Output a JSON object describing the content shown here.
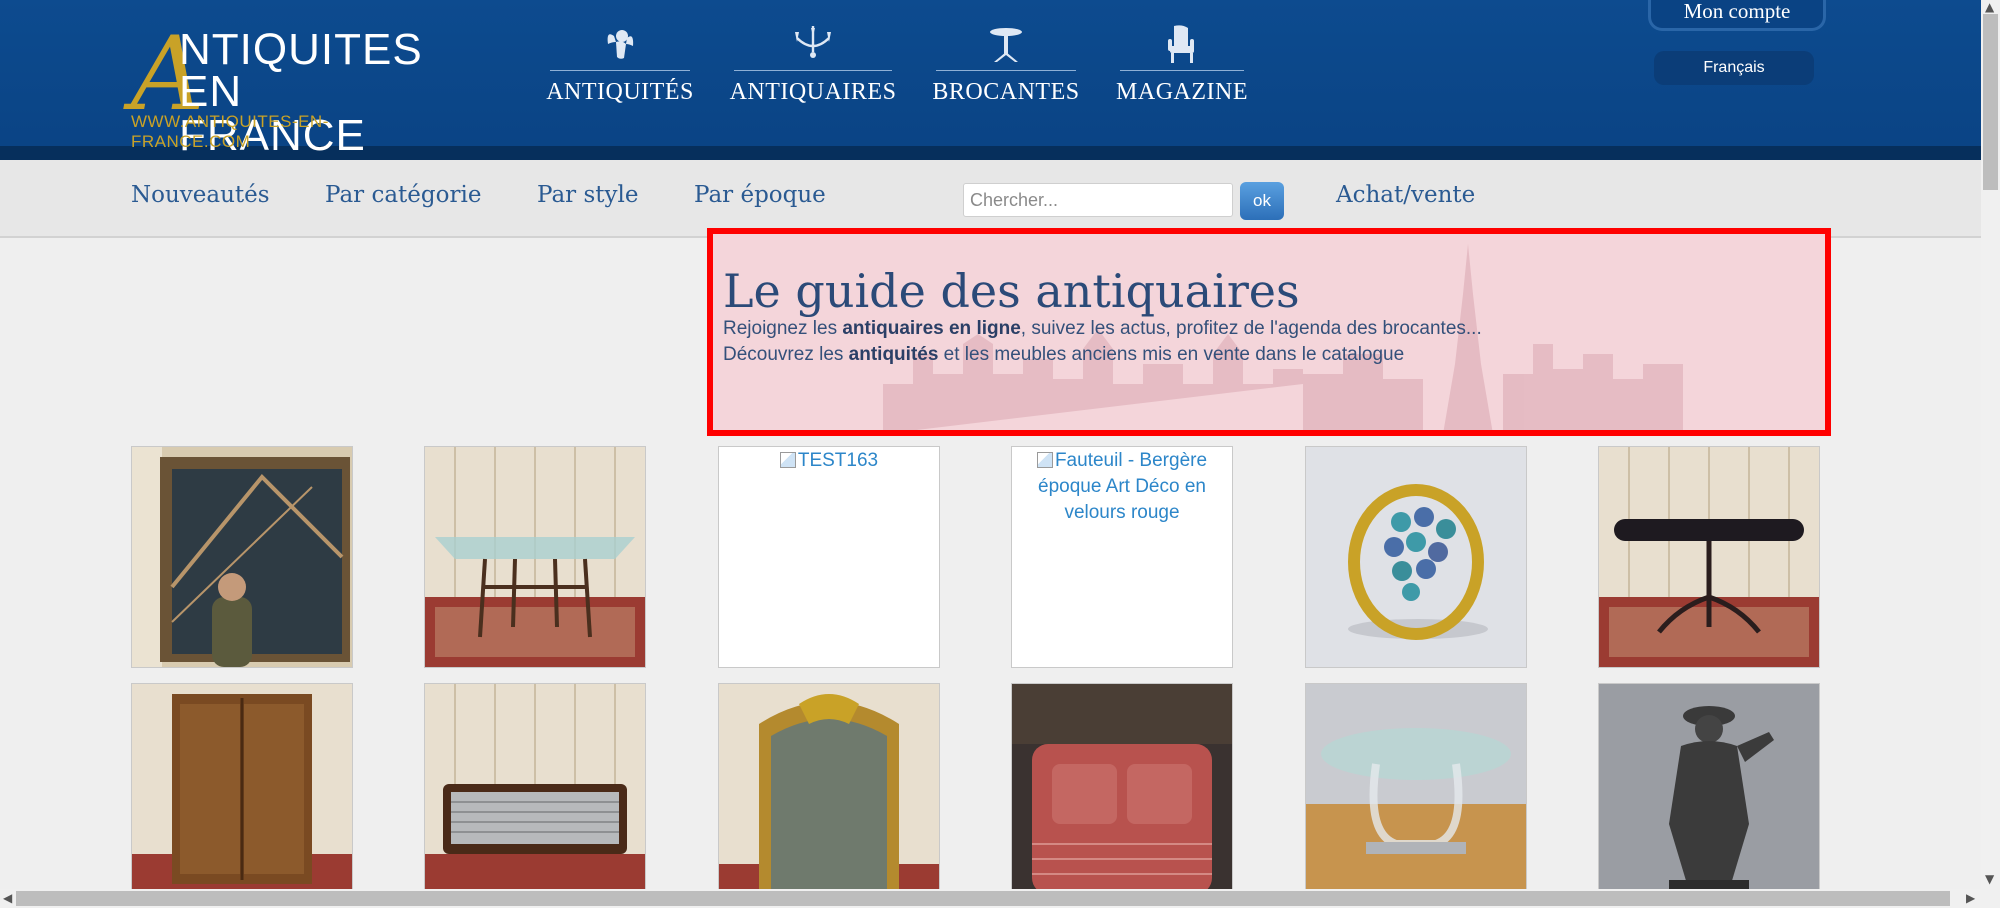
{
  "header": {
    "logo": {
      "letter": "A",
      "line1": "NTIQUITES",
      "line2": "EN FRANCE",
      "url": "WWW.ANTIQUITES-EN-FRANCE.COM"
    },
    "nav": [
      {
        "label": "ANTIQUITÉS",
        "icon": "cherub-icon"
      },
      {
        "label": "ANTIQUAIRES",
        "icon": "chandelier-icon"
      },
      {
        "label": "BROCANTES",
        "icon": "pedestal-table-icon"
      },
      {
        "label": "MAGAZINE",
        "icon": "armchair-icon"
      }
    ],
    "account_label": "Mon compte",
    "language_label": "Français"
  },
  "subnav": {
    "links": [
      "Nouveautés",
      "Par catégorie",
      "Par style",
      "Par époque"
    ],
    "search_placeholder": "Chercher...",
    "search_button": "ok",
    "buy_sell": "Achat/vente"
  },
  "guide": {
    "title": "Le guide des antiquaires",
    "line1_before": "Rejoignez les ",
    "line1_bold": "antiquaires en ligne",
    "line1_after": ", suivez les actus, profitez de l'agenda des brocantes...",
    "line2_before": "Découvrez les ",
    "line2_bold": "antiquités",
    "line2_after": " et les meubles anciens mis en vente dans le catalogue"
  },
  "products": [
    {
      "kind": "image",
      "subject": "mirror"
    },
    {
      "kind": "image",
      "subject": "glass-console-table"
    },
    {
      "kind": "broken",
      "alt": "TEST163"
    },
    {
      "kind": "broken",
      "alt": "Fauteuil - Bergère époque Art Déco en velours rouge"
    },
    {
      "kind": "image",
      "subject": "gold-ring"
    },
    {
      "kind": "image",
      "subject": "oval-side-table"
    },
    {
      "kind": "image",
      "subject": "wood-cabinet"
    },
    {
      "kind": "image",
      "subject": "striped-sofa"
    },
    {
      "kind": "image",
      "subject": "gilded-mirror"
    },
    {
      "kind": "image",
      "subject": "red-armchair"
    },
    {
      "kind": "image",
      "subject": "glass-oval-table"
    },
    {
      "kind": "image",
      "subject": "bronze-statue"
    }
  ],
  "colors": {
    "header_blue": "#0d4b8f",
    "gold": "#c9a227",
    "link_blue": "#2a5a92",
    "highlight_red": "#ff0000"
  }
}
